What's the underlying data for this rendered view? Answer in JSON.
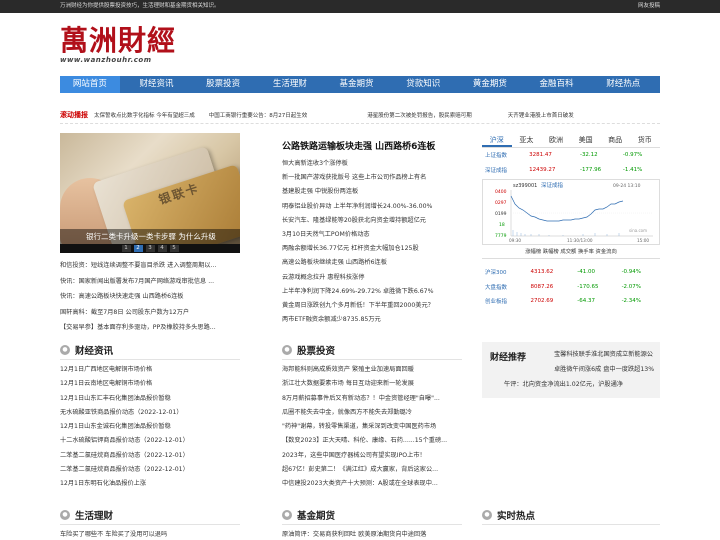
{
  "topbar": {
    "tagline": "万洲财经为你提供股票投资技巧，生活理财和基金期货相关知识。",
    "bookmark": "网友投稿"
  },
  "logo": {
    "text": "萬洲財經",
    "url": "www.wanzhouhr.com"
  },
  "nav": [
    "网站首页",
    "财经资讯",
    "股票投资",
    "生活理财",
    "基金期货",
    "贷款知识",
    "黄金期货",
    "金融百科",
    "财经热点"
  ],
  "ticker": {
    "title": "滚动播报",
    "items": [
      "太保誓收点比数字化指标 今年有望超三成",
      "中国工商银行重要公告：8月27日起生效",
      "港星股份第二次被处罚报告，股民索赔可期",
      "天齐锂业港股上市首日破发"
    ]
  },
  "slideshow": {
    "card_text": "银联卡",
    "caption": "银行二类卡升级一类卡步骤 为什么升级",
    "dots": [
      "1",
      "2",
      "3",
      "4",
      "5"
    ],
    "active_dot": 1
  },
  "left_news": [
    "和信投资：短线连续调整不要盲目杀跌 进入调整周期以...",
    "快讯：国家新闻出版署发布7月国产网络游戏审批信息 ...",
    "快讯：高速公路板块快速走强 山西路桥6连板",
    "国轩高科：截至7月8日 公司股东户数为12万户",
    "【交易早参】基本面存利多驱动，PP及橡胶持多头思路..."
  ],
  "headlines": {
    "title": "公路铁路运输板块走强 山西路桥6连板",
    "items": [
      "恒大高新连收3个涨停板",
      "新一批国产游戏获批版号 这些上市公司作品榜上有名",
      "基建股走强 中锐股份两连板",
      "明泰铝业股价异动 上半年净利润增长24.00%-36.00%",
      "长安汽车、隆基绿能等20股获北向资金增持额超亿元",
      "3月10日天然气工POM价格动态",
      "两融余额增长36.77亿元 杠杆资金大幅加仓125股",
      "高速公路板块继续走强 山西路桥6连板",
      "云游戏概念拉升 惠程科技涨停",
      "上半年净利润下降24.69%-29.72% 卓胜微下跌6.67%",
      "黄金周日涨跌创九个多月新低！下半年重回2000美元？",
      "两市ETF融资余额减少8735.85万元"
    ]
  },
  "market": {
    "tabs": [
      "沪深",
      "亚太",
      "欧洲",
      "美国",
      "商品",
      "货币"
    ],
    "active_tab": 0,
    "rows": [
      {
        "name": "上证指数",
        "value": "3281.47",
        "change": "-32.12",
        "pct": "-0.97%"
      },
      {
        "name": "深证成指",
        "value": "12439.27",
        "change": "-177.96",
        "pct": "-1.41%"
      }
    ],
    "chart": {
      "code": "sz399001",
      "title": "深证成指",
      "date": "09-24 13:10",
      "y_ticks": [
        "0400",
        "0297",
        "0199",
        "18",
        "7779"
      ],
      "x_ticks": [
        "09:30",
        "11:30/13:00",
        "15:00"
      ],
      "source": "sina.com"
    },
    "links": "涨幅榜 跌幅榜 成交额 换手率 资金流向",
    "rows2": [
      {
        "name": "沪深300",
        "value": "4313.62",
        "change": "-41.00",
        "pct": "-0.94%"
      },
      {
        "name": "大盘指数",
        "value": "8087.26",
        "change": "-170.65",
        "pct": "-2.07%"
      },
      {
        "name": "创业板指",
        "value": "2702.69",
        "change": "-64.37",
        "pct": "-2.34%"
      }
    ]
  },
  "sections": {
    "finance_news": {
      "title": "财经资讯",
      "items": [
        "12月1日广西地区电解铜市场价格",
        "12月1日云南地区电解铜市场价格",
        "12月1日山东汇丰石化集团油品报价暂稳",
        "无水硫酸亚铁商品报价动态（2022-12-01）",
        "12月1日山东金诚石化集团油品报价暂稳",
        "十二水硫酸铝钾商品报价动态（2022-12-01）",
        "二苯基二氯硅烷商品报价动态（2022-12-01）",
        "二苯基二氯硅烷商品报价动态（2022-12-01）",
        "12月1日东明石化油品报价上涨"
      ]
    },
    "stock": {
      "title": "股票投资",
      "items": [
        "海邦能科则高成质效资产 繁殖主业加速局面回暖",
        "浙江壮大数据要素市场 每日互动迎来新一轮发展",
        "8万月薪招募事件后又有新动态？！中金资管经理\"自曝\"...",
        "瓜圈不能失去中金，就像西方不能失去郑勤璐冷",
        "\"药神\"谢幕，转投零售渠道，集采深到改变中国医药市场",
        "【数变2023】正大天晴、科伦、康缘、石药......15个重磅...",
        "2023年，这些中国医疗器械公司有望实现IPO上市！",
        "超67亿！彭史第二！《满江红》成大赢家，背后这家公...",
        "中信建投2023大类资产十大预测：A股或在全球表现中..."
      ]
    },
    "finrec": {
      "title": "财经推荐",
      "lines": [
        "宝馨科技联手淮北国资成立新能源公",
        "卓胜微午间涨6成 盘中一度跌超13%",
        "午评：北向资金净流出1.02亿元，沪股通净"
      ]
    },
    "life": {
      "title": "生活理财",
      "first": "车险买了哪些不 车险买了没用可以退吗"
    },
    "fund": {
      "title": "基金期货",
      "first": "原油简评：交易商获利回吐 欧美原油期货向中途回落"
    },
    "hot": {
      "title": "实时热点"
    }
  }
}
